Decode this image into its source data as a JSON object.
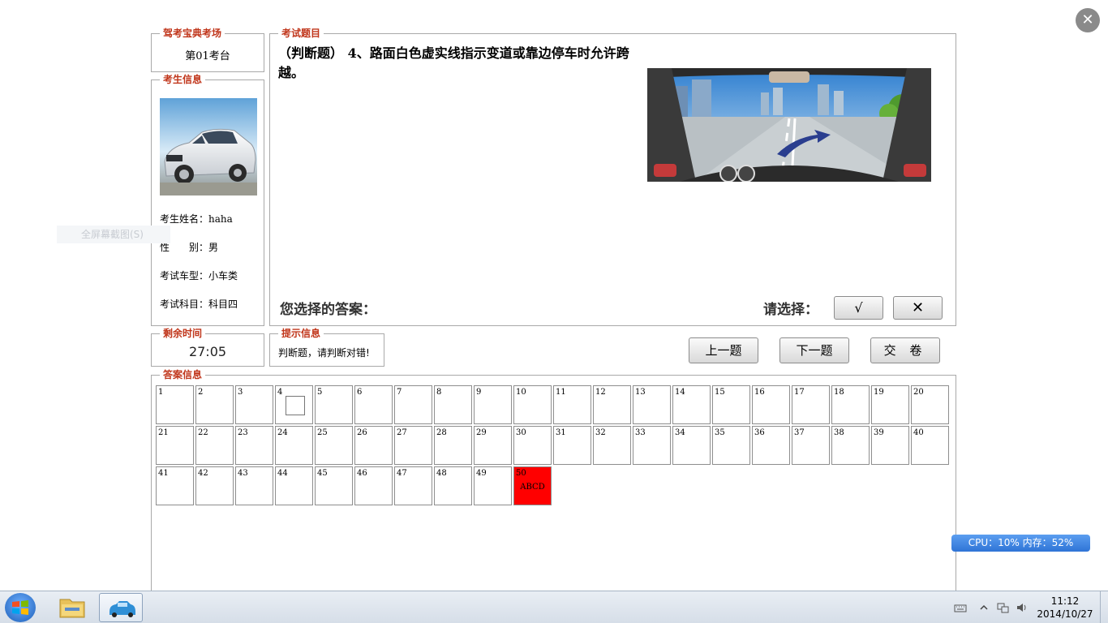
{
  "window": {
    "close_symbol": "✕"
  },
  "station": {
    "legend": "驾考宝典考场",
    "name": "第01考台"
  },
  "examinee": {
    "legend": "考生信息",
    "rows": [
      {
        "label": "考生姓名：",
        "value": "haha"
      },
      {
        "label": "性　　别：",
        "value": "男"
      },
      {
        "label": "考试车型：",
        "value": "小车类"
      },
      {
        "label": "考试科目：",
        "value": "科目四"
      }
    ]
  },
  "question": {
    "legend": "考试题目",
    "text": "（判断题） 4、路面白色虚实线指示变道或靠边停车时允许跨越。",
    "your_answer_label": "您选择的答案：",
    "your_answer_value": "",
    "please_choose_label": "请选择：",
    "true_label": "√",
    "false_label": "✕"
  },
  "timer": {
    "legend": "剩余时间",
    "value": "27:05"
  },
  "hint": {
    "legend": "提示信息",
    "text": "判断题，请判断对错!"
  },
  "nav": {
    "prev": "上一题",
    "next": "下一题",
    "submit": "交 卷"
  },
  "answers": {
    "legend": "答案信息",
    "current_index": 50,
    "current_answer": "ABCD",
    "marked_index": 4,
    "count": 50
  },
  "ghost_menu": {
    "text": "全屏幕截图(S)"
  },
  "cpu_widget": {
    "text": "CPU：10%  内存：52%"
  },
  "taskbar": {
    "apps": [
      "windows-explorer",
      "driving-exam"
    ],
    "time": "11:12",
    "date": "2014/10/27"
  },
  "colors": {
    "legend": "#c0351a",
    "current_cell": "#ff0000",
    "cpu_widget": "#2f74d6"
  }
}
